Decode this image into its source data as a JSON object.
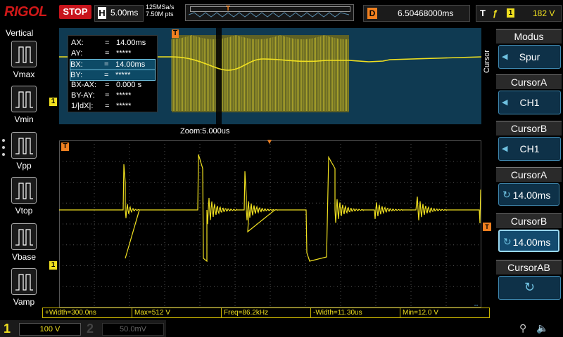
{
  "brand": {
    "logo": "RIGOL"
  },
  "top": {
    "run_state": "STOP",
    "timebase_label": "H",
    "timebase": "5.00ms",
    "sample_rate": "125MSa/s",
    "mem_depth": "7.50M pts",
    "delay_label": "D",
    "delay": "6.50468000ms",
    "trigger_label": "T",
    "trigger_edge": "ƒ",
    "trigger_channel": "1",
    "trigger_level": "182 V"
  },
  "left_menu": {
    "title": "Vertical",
    "items": [
      {
        "label": "Vmax",
        "icon": "vmax-icon"
      },
      {
        "label": "Vmin",
        "icon": "vmin-icon"
      },
      {
        "label": "Vpp",
        "icon": "vpp-icon"
      },
      {
        "label": "Vtop",
        "icon": "vtop-icon"
      },
      {
        "label": "Vbase",
        "icon": "vbase-icon"
      },
      {
        "label": "Vamp",
        "icon": "vamp-icon"
      }
    ]
  },
  "zoom": {
    "label": "Zoom:5.000us"
  },
  "cursor_readout": [
    {
      "key": "AX:",
      "eq": "=",
      "value": "14.00ms",
      "selected": false
    },
    {
      "key": "AY:",
      "eq": "=",
      "value": "*****",
      "selected": false
    },
    {
      "key": "BX:",
      "eq": "=",
      "value": "14.00ms",
      "selected": true
    },
    {
      "key": "BY:",
      "eq": "=",
      "value": "*****",
      "selected": true
    },
    {
      "key": "BX-AX:",
      "eq": "=",
      "value": "0.000 s",
      "selected": false
    },
    {
      "key": "BY-AY:",
      "eq": "=",
      "value": "*****",
      "selected": false
    },
    {
      "key": "1/|dX|:",
      "eq": "=",
      "value": "*****",
      "selected": false
    }
  ],
  "markers": {
    "t": "T",
    "ch1": "1"
  },
  "measurements": [
    {
      "text": "+Width=300.0ns"
    },
    {
      "text": "Max=512 V"
    },
    {
      "text": "Freq=86.2kHz"
    },
    {
      "text": "-Width=11.30us"
    },
    {
      "text": "Min=12.0 V"
    }
  ],
  "channels": [
    {
      "num": "1",
      "scale": "100 V",
      "active": true
    },
    {
      "num": "2",
      "scale": "50.0mV",
      "active": false
    }
  ],
  "right_menu": {
    "tab": "Cursor",
    "keys": [
      {
        "title": "Modus",
        "value": "Spur",
        "kind": "select"
      },
      {
        "title": "CursorA",
        "value": "CH1",
        "kind": "select"
      },
      {
        "title": "CursorB",
        "value": "CH1",
        "kind": "select"
      },
      {
        "title": "CursorA",
        "value": "14.00ms",
        "kind": "knob"
      },
      {
        "title": "CursorB",
        "value": "14.00ms",
        "kind": "knob"
      },
      {
        "title": "CursorAB",
        "value": "",
        "kind": "knob"
      }
    ]
  },
  "colors": {
    "ch1": "#f0e020",
    "trigger": "#f08020",
    "accent": "#3f88b0",
    "stop": "#c8141c"
  }
}
